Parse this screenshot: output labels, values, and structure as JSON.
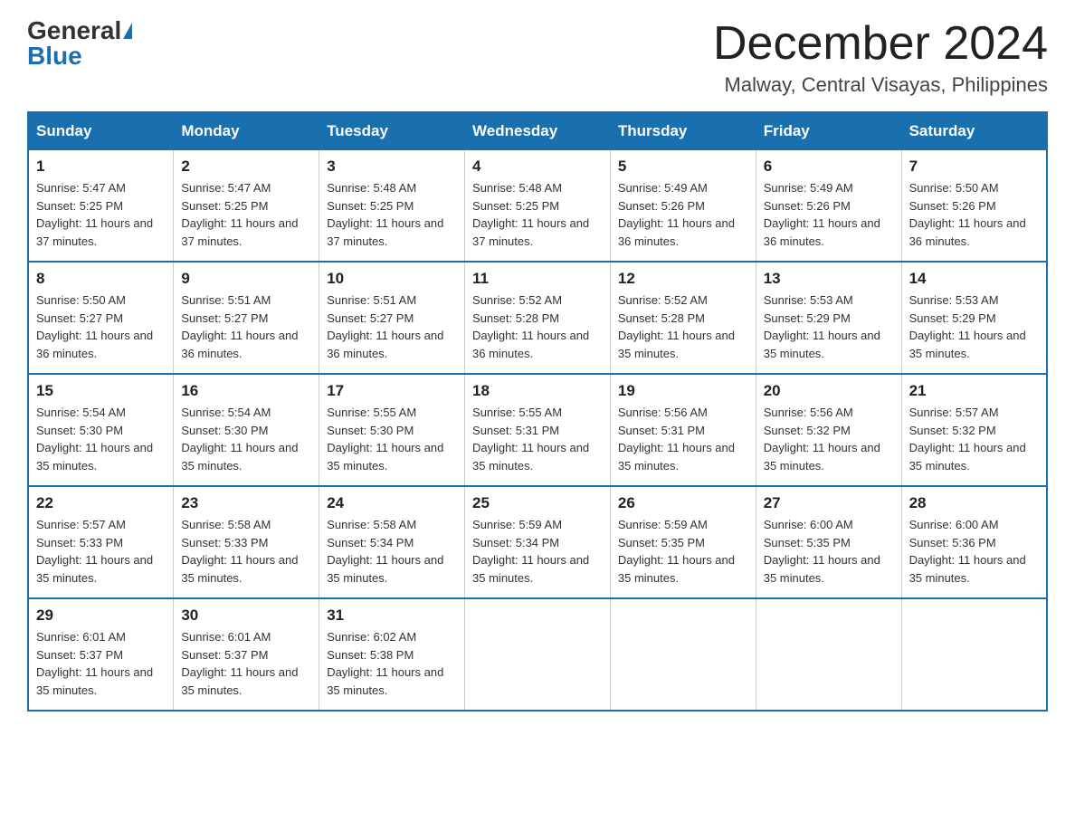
{
  "header": {
    "logo_general": "General",
    "logo_blue": "Blue",
    "month_title": "December 2024",
    "location": "Malway, Central Visayas, Philippines"
  },
  "weekdays": [
    "Sunday",
    "Monday",
    "Tuesday",
    "Wednesday",
    "Thursday",
    "Friday",
    "Saturday"
  ],
  "weeks": [
    [
      {
        "day": "1",
        "sunrise": "5:47 AM",
        "sunset": "5:25 PM",
        "daylight": "11 hours and 37 minutes."
      },
      {
        "day": "2",
        "sunrise": "5:47 AM",
        "sunset": "5:25 PM",
        "daylight": "11 hours and 37 minutes."
      },
      {
        "day": "3",
        "sunrise": "5:48 AM",
        "sunset": "5:25 PM",
        "daylight": "11 hours and 37 minutes."
      },
      {
        "day": "4",
        "sunrise": "5:48 AM",
        "sunset": "5:25 PM",
        "daylight": "11 hours and 37 minutes."
      },
      {
        "day": "5",
        "sunrise": "5:49 AM",
        "sunset": "5:26 PM",
        "daylight": "11 hours and 36 minutes."
      },
      {
        "day": "6",
        "sunrise": "5:49 AM",
        "sunset": "5:26 PM",
        "daylight": "11 hours and 36 minutes."
      },
      {
        "day": "7",
        "sunrise": "5:50 AM",
        "sunset": "5:26 PM",
        "daylight": "11 hours and 36 minutes."
      }
    ],
    [
      {
        "day": "8",
        "sunrise": "5:50 AM",
        "sunset": "5:27 PM",
        "daylight": "11 hours and 36 minutes."
      },
      {
        "day": "9",
        "sunrise": "5:51 AM",
        "sunset": "5:27 PM",
        "daylight": "11 hours and 36 minutes."
      },
      {
        "day": "10",
        "sunrise": "5:51 AM",
        "sunset": "5:27 PM",
        "daylight": "11 hours and 36 minutes."
      },
      {
        "day": "11",
        "sunrise": "5:52 AM",
        "sunset": "5:28 PM",
        "daylight": "11 hours and 36 minutes."
      },
      {
        "day": "12",
        "sunrise": "5:52 AM",
        "sunset": "5:28 PM",
        "daylight": "11 hours and 35 minutes."
      },
      {
        "day": "13",
        "sunrise": "5:53 AM",
        "sunset": "5:29 PM",
        "daylight": "11 hours and 35 minutes."
      },
      {
        "day": "14",
        "sunrise": "5:53 AM",
        "sunset": "5:29 PM",
        "daylight": "11 hours and 35 minutes."
      }
    ],
    [
      {
        "day": "15",
        "sunrise": "5:54 AM",
        "sunset": "5:30 PM",
        "daylight": "11 hours and 35 minutes."
      },
      {
        "day": "16",
        "sunrise": "5:54 AM",
        "sunset": "5:30 PM",
        "daylight": "11 hours and 35 minutes."
      },
      {
        "day": "17",
        "sunrise": "5:55 AM",
        "sunset": "5:30 PM",
        "daylight": "11 hours and 35 minutes."
      },
      {
        "day": "18",
        "sunrise": "5:55 AM",
        "sunset": "5:31 PM",
        "daylight": "11 hours and 35 minutes."
      },
      {
        "day": "19",
        "sunrise": "5:56 AM",
        "sunset": "5:31 PM",
        "daylight": "11 hours and 35 minutes."
      },
      {
        "day": "20",
        "sunrise": "5:56 AM",
        "sunset": "5:32 PM",
        "daylight": "11 hours and 35 minutes."
      },
      {
        "day": "21",
        "sunrise": "5:57 AM",
        "sunset": "5:32 PM",
        "daylight": "11 hours and 35 minutes."
      }
    ],
    [
      {
        "day": "22",
        "sunrise": "5:57 AM",
        "sunset": "5:33 PM",
        "daylight": "11 hours and 35 minutes."
      },
      {
        "day": "23",
        "sunrise": "5:58 AM",
        "sunset": "5:33 PM",
        "daylight": "11 hours and 35 minutes."
      },
      {
        "day": "24",
        "sunrise": "5:58 AM",
        "sunset": "5:34 PM",
        "daylight": "11 hours and 35 minutes."
      },
      {
        "day": "25",
        "sunrise": "5:59 AM",
        "sunset": "5:34 PM",
        "daylight": "11 hours and 35 minutes."
      },
      {
        "day": "26",
        "sunrise": "5:59 AM",
        "sunset": "5:35 PM",
        "daylight": "11 hours and 35 minutes."
      },
      {
        "day": "27",
        "sunrise": "6:00 AM",
        "sunset": "5:35 PM",
        "daylight": "11 hours and 35 minutes."
      },
      {
        "day": "28",
        "sunrise": "6:00 AM",
        "sunset": "5:36 PM",
        "daylight": "11 hours and 35 minutes."
      }
    ],
    [
      {
        "day": "29",
        "sunrise": "6:01 AM",
        "sunset": "5:37 PM",
        "daylight": "11 hours and 35 minutes."
      },
      {
        "day": "30",
        "sunrise": "6:01 AM",
        "sunset": "5:37 PM",
        "daylight": "11 hours and 35 minutes."
      },
      {
        "day": "31",
        "sunrise": "6:02 AM",
        "sunset": "5:38 PM",
        "daylight": "11 hours and 35 minutes."
      },
      null,
      null,
      null,
      null
    ]
  ]
}
